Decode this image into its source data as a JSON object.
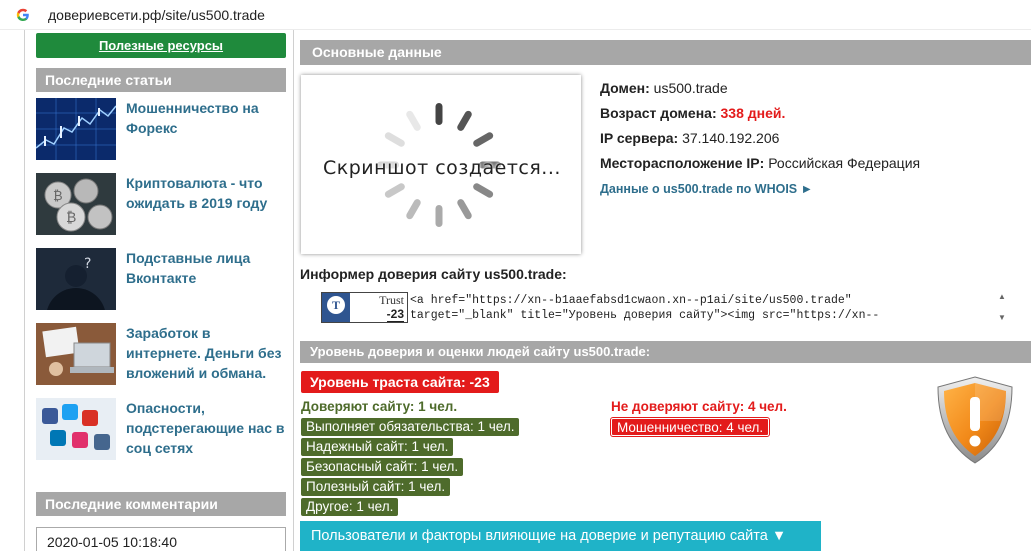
{
  "browser": {
    "address": "довериевсети.рф/site/us500.trade"
  },
  "sidebar": {
    "resources_button": "Полезные ресурсы",
    "articles_heading": "Последние статьи",
    "articles": [
      {
        "title": "Мошенничество на Форекс"
      },
      {
        "title": "Криптовалюта - что ожидать в 2019 году"
      },
      {
        "title": "Подставные лица Вконтакте"
      },
      {
        "title": "Заработок в интернете. Деньги без вложений и обмана."
      },
      {
        "title": "Опасности, подстерегающие нас в соц сетях"
      }
    ],
    "comments_heading": "Последние комментарии",
    "comment_date": "2020-01-05 10:18:40"
  },
  "main": {
    "heading": "Основные данные",
    "screenshot_caption": "Скриншот создается...",
    "domain_label": "Домен:",
    "domain_value": "us500.trade",
    "age_label": "Возраст домена:",
    "age_value": "338 дней.",
    "ip_label": "IP сервера:",
    "ip_value": "37.140.192.206",
    "location_label": "Месторасположение IP:",
    "location_value": "Российская Федерация",
    "whois_link": "Данные о us500.trade по WHOIS ►",
    "informer_title": "Информер доверия сайту us500.trade:",
    "badge_trust": "Trust",
    "badge_score": "-23",
    "informer_code": "<a href=\"https://xn--b1aaefabsd1cwaon.xn--p1ai/site/us500.trade\"\ntarget=\"_blank\" title=\"Уровень доверия сайту\"><img src=\"https://xn--"
  },
  "trust": {
    "heading": "Уровень доверия и оценки людей сайту us500.trade:",
    "level": "Уровень траста сайта: -23",
    "trust_title": "Доверяют сайту: 1 чел.",
    "trust_tags": [
      "Выполняет обязательства: 1 чел.",
      "Надежный сайт: 1 чел.",
      "Безопасный сайт: 1 чел.",
      "Полезный сайт: 1 чел.",
      "Другое: 1 чел."
    ],
    "distrust_title": "Не доверяют сайту: 4 чел.",
    "distrust_tags": [
      "Мошенничество: 4 чел."
    ],
    "factors_button": "Пользователи и факторы влияющие на доверие и репутацию сайта ▼"
  },
  "colors": {
    "green": "#1f8a3c",
    "olive": "#4e6b2b",
    "red": "#e31b1b",
    "gray_header": "#a7a7a7",
    "link_blue": "#2e6e8c",
    "cyan_button": "#1fb3c8"
  },
  "icons": {
    "browser": "google-g-icon",
    "warning": "warning-shield-icon"
  }
}
